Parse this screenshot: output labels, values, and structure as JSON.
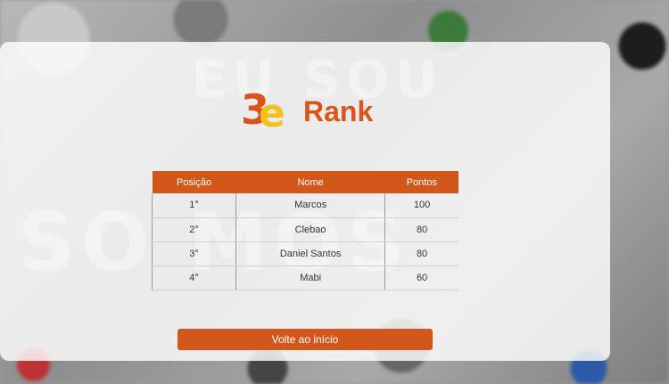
{
  "brand": {
    "logo_digit": "3",
    "logo_letter": "e",
    "title": "Rank"
  },
  "table": {
    "headers": [
      "Posição",
      "Nome",
      "Pontos"
    ],
    "rows": [
      [
        "1°",
        "Marcos",
        "100"
      ],
      [
        "2°",
        "Clebao",
        "80"
      ],
      [
        "3°",
        "Daniel Santos",
        "80"
      ],
      [
        "4°",
        "Mabi",
        "60"
      ]
    ]
  },
  "actions": {
    "back_label": "Volte ao início"
  },
  "colors": {
    "accent": "#d2571b",
    "logo_yellow": "#f2c21b"
  }
}
